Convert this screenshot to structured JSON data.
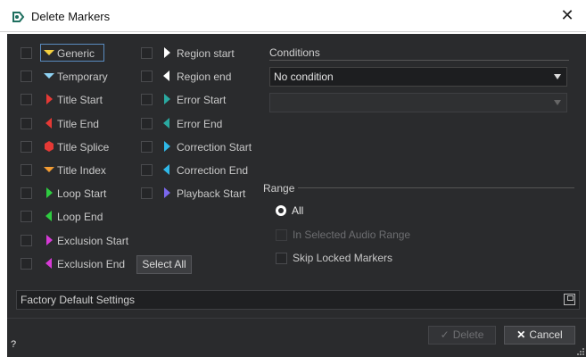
{
  "window": {
    "title": "Delete Markers",
    "close_label": "✕"
  },
  "markers": [
    {
      "label": "Generic",
      "color": "#f4d03f",
      "shape": "down-triangle",
      "checked": false,
      "selected": true
    },
    {
      "label": "Temporary",
      "color": "#8fd3f4",
      "shape": "down-triangle",
      "checked": false
    },
    {
      "label": "Title Start",
      "color": "#e53935",
      "shape": "right-half",
      "checked": false
    },
    {
      "label": "Title End",
      "color": "#e53935",
      "shape": "left-half",
      "checked": false
    },
    {
      "label": "Title Splice",
      "color": "#e53935",
      "shape": "hexagon",
      "checked": false
    },
    {
      "label": "Title Index",
      "color": "#f39c33",
      "shape": "down-triangle",
      "checked": false
    },
    {
      "label": "Loop Start",
      "color": "#2ecc40",
      "shape": "right-half",
      "checked": false
    },
    {
      "label": "Loop End",
      "color": "#2ecc40",
      "shape": "left-half",
      "checked": false
    },
    {
      "label": "Exclusion Start",
      "color": "#d63ad6",
      "shape": "right-half",
      "checked": false
    },
    {
      "label": "Exclusion End",
      "color": "#d63ad6",
      "shape": "left-half",
      "checked": false
    },
    {
      "label": "Region start",
      "color": "#ffffff",
      "shape": "right-half",
      "checked": false
    },
    {
      "label": "Region end",
      "color": "#ffffff",
      "shape": "left-half",
      "checked": false
    },
    {
      "label": "Error Start",
      "color": "#2aa9a0",
      "shape": "right-half",
      "checked": false
    },
    {
      "label": "Error End",
      "color": "#2aa9a0",
      "shape": "left-half",
      "checked": false
    },
    {
      "label": "Correction Start",
      "color": "#2fb8e8",
      "shape": "right-half",
      "checked": false
    },
    {
      "label": "Correction End",
      "color": "#2fb8e8",
      "shape": "left-half",
      "checked": false
    },
    {
      "label": "Playback Start",
      "color": "#7b68ee",
      "shape": "right-half",
      "checked": false
    }
  ],
  "select_all_label": "Select All",
  "conditions": {
    "title": "Conditions",
    "selected": "No condition",
    "secondary_value": ""
  },
  "range": {
    "title": "Range",
    "options": [
      {
        "label": "All",
        "checked": true,
        "enabled": true
      },
      {
        "label": "In Selected Audio Range",
        "checked": false,
        "enabled": false
      }
    ],
    "skip_locked_label": "Skip Locked Markers",
    "skip_locked_checked": false
  },
  "presets": {
    "value": "Factory Default Settings"
  },
  "buttons": {
    "delete_label": "Delete",
    "cancel_label": "Cancel"
  },
  "help_label": "?"
}
